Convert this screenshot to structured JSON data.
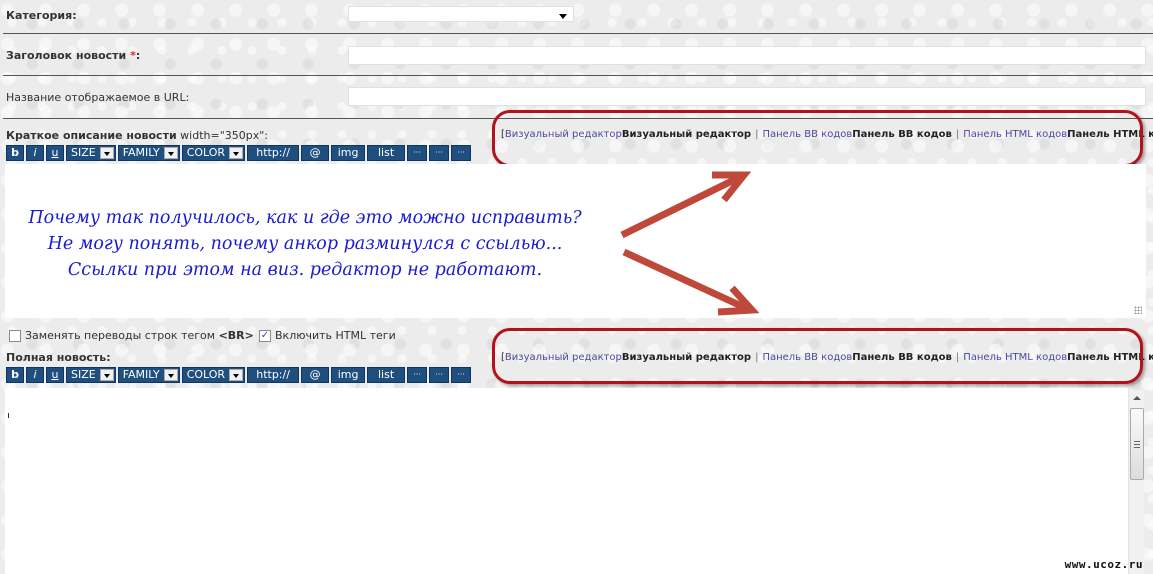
{
  "form": {
    "category": {
      "label": "Категория",
      "colon": ":",
      "selected": ""
    },
    "title": {
      "label": "Заголовок новости",
      "required_mark": "*",
      "colon": ":",
      "value": ""
    },
    "url_name": {
      "label": "Название отображаемое в URL:",
      "value": ""
    },
    "short_desc": {
      "label": "Краткое описание новости",
      "hint": " width=\"350px\":",
      "content": ""
    },
    "full_news": {
      "label": "Полная новость:",
      "content": ""
    },
    "options": {
      "replace_br": {
        "label_prefix": "Заменять переводы строк тегом ",
        "label_tag": "<BR>",
        "checked": false
      },
      "enable_html": {
        "label": "Включить HTML теги",
        "checked": true
      }
    }
  },
  "toolbar": {
    "buttons": [
      {
        "id": "bold",
        "label": "b"
      },
      {
        "id": "italic",
        "label": "i"
      },
      {
        "id": "underline",
        "label": "u"
      },
      {
        "id": "size",
        "label": "SIZE",
        "dropdown": true
      },
      {
        "id": "family",
        "label": "FAMILY",
        "dropdown": true
      },
      {
        "id": "color",
        "label": "COLOR",
        "dropdown": true
      },
      {
        "id": "url",
        "label": "http://"
      },
      {
        "id": "email",
        "label": "@"
      },
      {
        "id": "img",
        "label": "img"
      },
      {
        "id": "list",
        "label": "list"
      },
      {
        "id": "more1",
        "label": "···"
      },
      {
        "id": "more2",
        "label": "···"
      },
      {
        "id": "more3",
        "label": "···"
      }
    ]
  },
  "editor_switch": {
    "open_bracket": "[",
    "close_bracket": "]",
    "separator": "|",
    "items": [
      {
        "link": "Визуальный редактор",
        "active": "Визуальный редактор"
      },
      {
        "link": "Панель BB кодов",
        "active": "Панель BB кодов"
      },
      {
        "link": "Панель HTML кодов",
        "active": "Панель HTML кодов"
      }
    ]
  },
  "annotation": {
    "lines": [
      "Почему так получилось, как  и где это  можно исправить?",
      "Не могу понять, почему анкор разминулся с ссылью...",
      "Ссылки при этом на виз. редактор не работают."
    ],
    "color": "#1a1ad0",
    "highlight_color": "#b3121a",
    "arrow_color": "#c0483a"
  },
  "watermark": "www.ucoz.ru"
}
